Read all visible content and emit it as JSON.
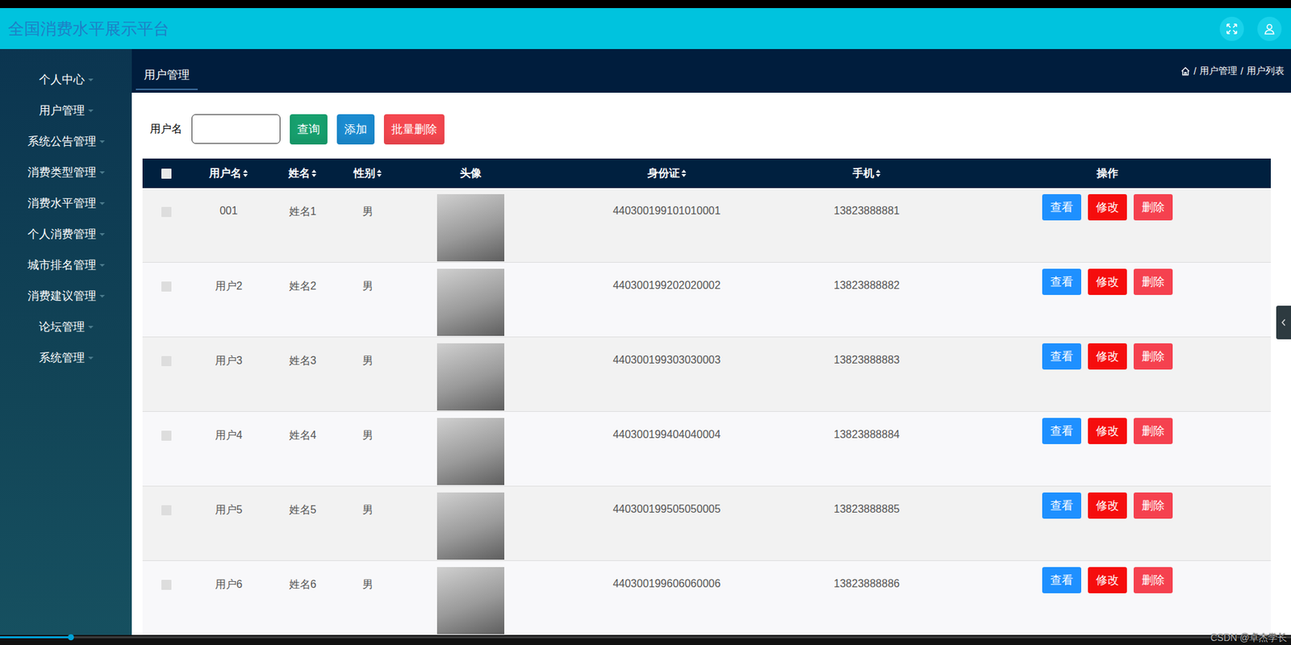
{
  "header": {
    "title": "全国消费水平展示平台"
  },
  "sidebar": {
    "items": [
      {
        "label": "个人中心",
        "expanded": false
      },
      {
        "label": "用户管理",
        "expanded": false
      },
      {
        "label": "系统公告管理",
        "expanded": false
      },
      {
        "label": "消费类型管理",
        "expanded": false
      },
      {
        "label": "消费水平管理",
        "expanded": false
      },
      {
        "label": "个人消费管理",
        "expanded": false
      },
      {
        "label": "城市排名管理",
        "expanded": false
      },
      {
        "label": "消费建议管理",
        "expanded": false
      },
      {
        "label": "论坛管理",
        "expanded": false
      },
      {
        "label": "系统管理",
        "expanded": false
      }
    ]
  },
  "tabs": [
    {
      "label": "用户管理",
      "selected": true
    }
  ],
  "breadcrumb": {
    "separator": "/",
    "items": [
      "用户管理",
      "用户列表"
    ]
  },
  "search": {
    "label": "用户名",
    "value": ""
  },
  "buttons": [
    {
      "label": "查询",
      "color": "#17a06e"
    },
    {
      "label": "添加",
      "color": "#1b8bd0"
    },
    {
      "label": "批量删除",
      "color": "#f4474f"
    }
  ],
  "table": {
    "select_all": {
      "checked": false
    },
    "columns": [
      {
        "label": "用户名",
        "sortable": true,
        "kind": "text"
      },
      {
        "label": "姓名",
        "sortable": true,
        "kind": "text"
      },
      {
        "label": "性别",
        "sortable": true,
        "kind": "text"
      },
      {
        "label": "头像",
        "sortable": false,
        "kind": "image"
      },
      {
        "label": "身份证",
        "sortable": true,
        "kind": "text"
      },
      {
        "label": "手机",
        "sortable": true,
        "kind": "text"
      },
      {
        "label": "操作",
        "sortable": false,
        "kind": "actions"
      }
    ],
    "rows": [
      {
        "checked": false,
        "cells": [
          "001",
          "姓名1",
          "男",
          "440300199101010001",
          "13823888881"
        ],
        "actions": [
          {
            "label": "查看",
            "color": "#1e90ff"
          },
          {
            "label": "修改",
            "color": "#f50d0d"
          },
          {
            "label": "删除",
            "color": "#f5414f"
          }
        ]
      },
      {
        "checked": false,
        "cells": [
          "用户2",
          "姓名2",
          "男",
          "440300199202020002",
          "13823888882"
        ],
        "actions": [
          {
            "label": "查看",
            "color": "#1e90ff"
          },
          {
            "label": "修改",
            "color": "#f50d0d"
          },
          {
            "label": "删除",
            "color": "#f5414f"
          }
        ]
      },
      {
        "checked": false,
        "cells": [
          "用户3",
          "姓名3",
          "男",
          "440300199303030003",
          "13823888883"
        ],
        "actions": [
          {
            "label": "查看",
            "color": "#1e90ff"
          },
          {
            "label": "修改",
            "color": "#f50d0d"
          },
          {
            "label": "删除",
            "color": "#f5414f"
          }
        ]
      },
      {
        "checked": false,
        "cells": [
          "用户4",
          "姓名4",
          "男",
          "440300199404040004",
          "13823888884"
        ],
        "actions": [
          {
            "label": "查看",
            "color": "#1e90ff"
          },
          {
            "label": "修改",
            "color": "#f50d0d"
          },
          {
            "label": "删除",
            "color": "#f5414f"
          }
        ]
      },
      {
        "checked": false,
        "cells": [
          "用户5",
          "姓名5",
          "男",
          "440300199505050005",
          "13823888885"
        ],
        "actions": [
          {
            "label": "查看",
            "color": "#1e90ff"
          },
          {
            "label": "修改",
            "color": "#f50d0d"
          },
          {
            "label": "删除",
            "color": "#f5414f"
          }
        ]
      },
      {
        "checked": false,
        "cells": [
          "用户6",
          "姓名6",
          "男",
          "440300199606060006",
          "13823888886"
        ],
        "actions": [
          {
            "label": "查看",
            "color": "#1e90ff"
          },
          {
            "label": "修改",
            "color": "#f50d0d"
          },
          {
            "label": "删除",
            "color": "#f5414f"
          }
        ]
      }
    ]
  },
  "video": {
    "level": 0.055
  },
  "watermark": "CSDN @卓杰学长"
}
